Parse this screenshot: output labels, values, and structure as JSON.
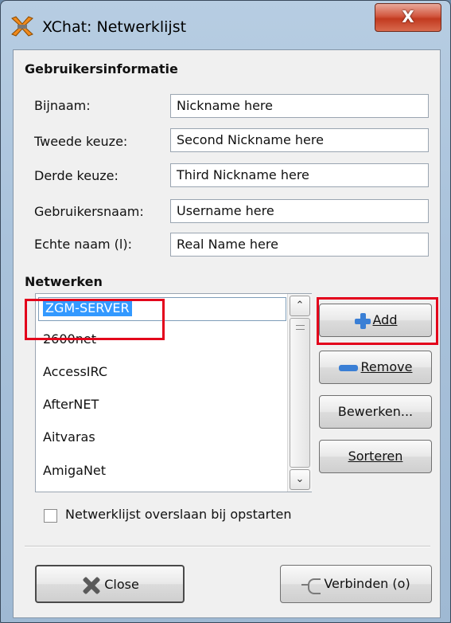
{
  "window": {
    "title": "XChat: Netwerklijst",
    "close_glyph": "X",
    "icon": "xchat-app-icon"
  },
  "user_info": {
    "section_title": "Gebruikersinformatie",
    "fields": [
      {
        "label": "Bijnaam:",
        "value": "Nickname here"
      },
      {
        "label": "Tweede keuze:",
        "value": "Second Nickname here"
      },
      {
        "label": "Derde keuze:",
        "value": "Third Nickname here"
      },
      {
        "label": "Gebruikersnaam:",
        "value": "Username here"
      },
      {
        "label": "Echte naam (l):",
        "value": "Real Name here"
      }
    ]
  },
  "networks": {
    "section_title": "Netwerken",
    "selected": "ZGM-SERVER",
    "items": [
      "ZGM-SERVER",
      "2600net",
      "AccessIRC",
      "AfterNET",
      "Aitvaras",
      "AmigaNet"
    ]
  },
  "buttons": {
    "add": "Add",
    "remove": "Remove",
    "edit": "Bewerken...",
    "sort": "Sorteren",
    "close": "Close",
    "connect": "Verbinden (o)"
  },
  "options": {
    "skip_label": "Netwerklijst overslaan bij opstarten",
    "skip_checked": false
  },
  "colors": {
    "selection": "#3399ff",
    "highlight_box": "#e3001b",
    "icon_accent": "#3a7fd5"
  }
}
